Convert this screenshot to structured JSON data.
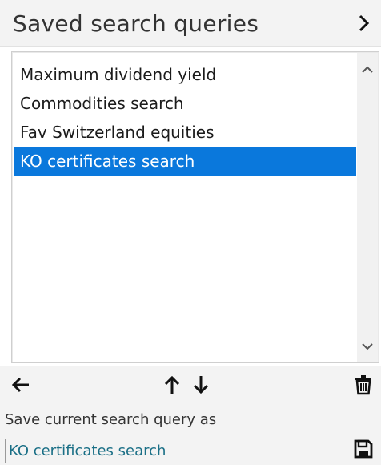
{
  "header": {
    "title": "Saved search queries",
    "collapse_icon": "chevron-right-icon"
  },
  "list": {
    "items": [
      {
        "label": "Maximum dividend yield",
        "selected": false
      },
      {
        "label": "Commodities search",
        "selected": false
      },
      {
        "label": "Fav Switzerland equities",
        "selected": false
      },
      {
        "label": "KO certificates search",
        "selected": true
      }
    ],
    "selection_color": "#0a78dc"
  },
  "toolbar": {
    "back_icon": "arrow-left-icon",
    "move_up_icon": "arrow-up-icon",
    "move_down_icon": "arrow-down-icon",
    "delete_icon": "trash-icon"
  },
  "save": {
    "label": "Save current search query as",
    "input_value": "KO certificates search",
    "save_icon": "floppy-disk-icon"
  }
}
